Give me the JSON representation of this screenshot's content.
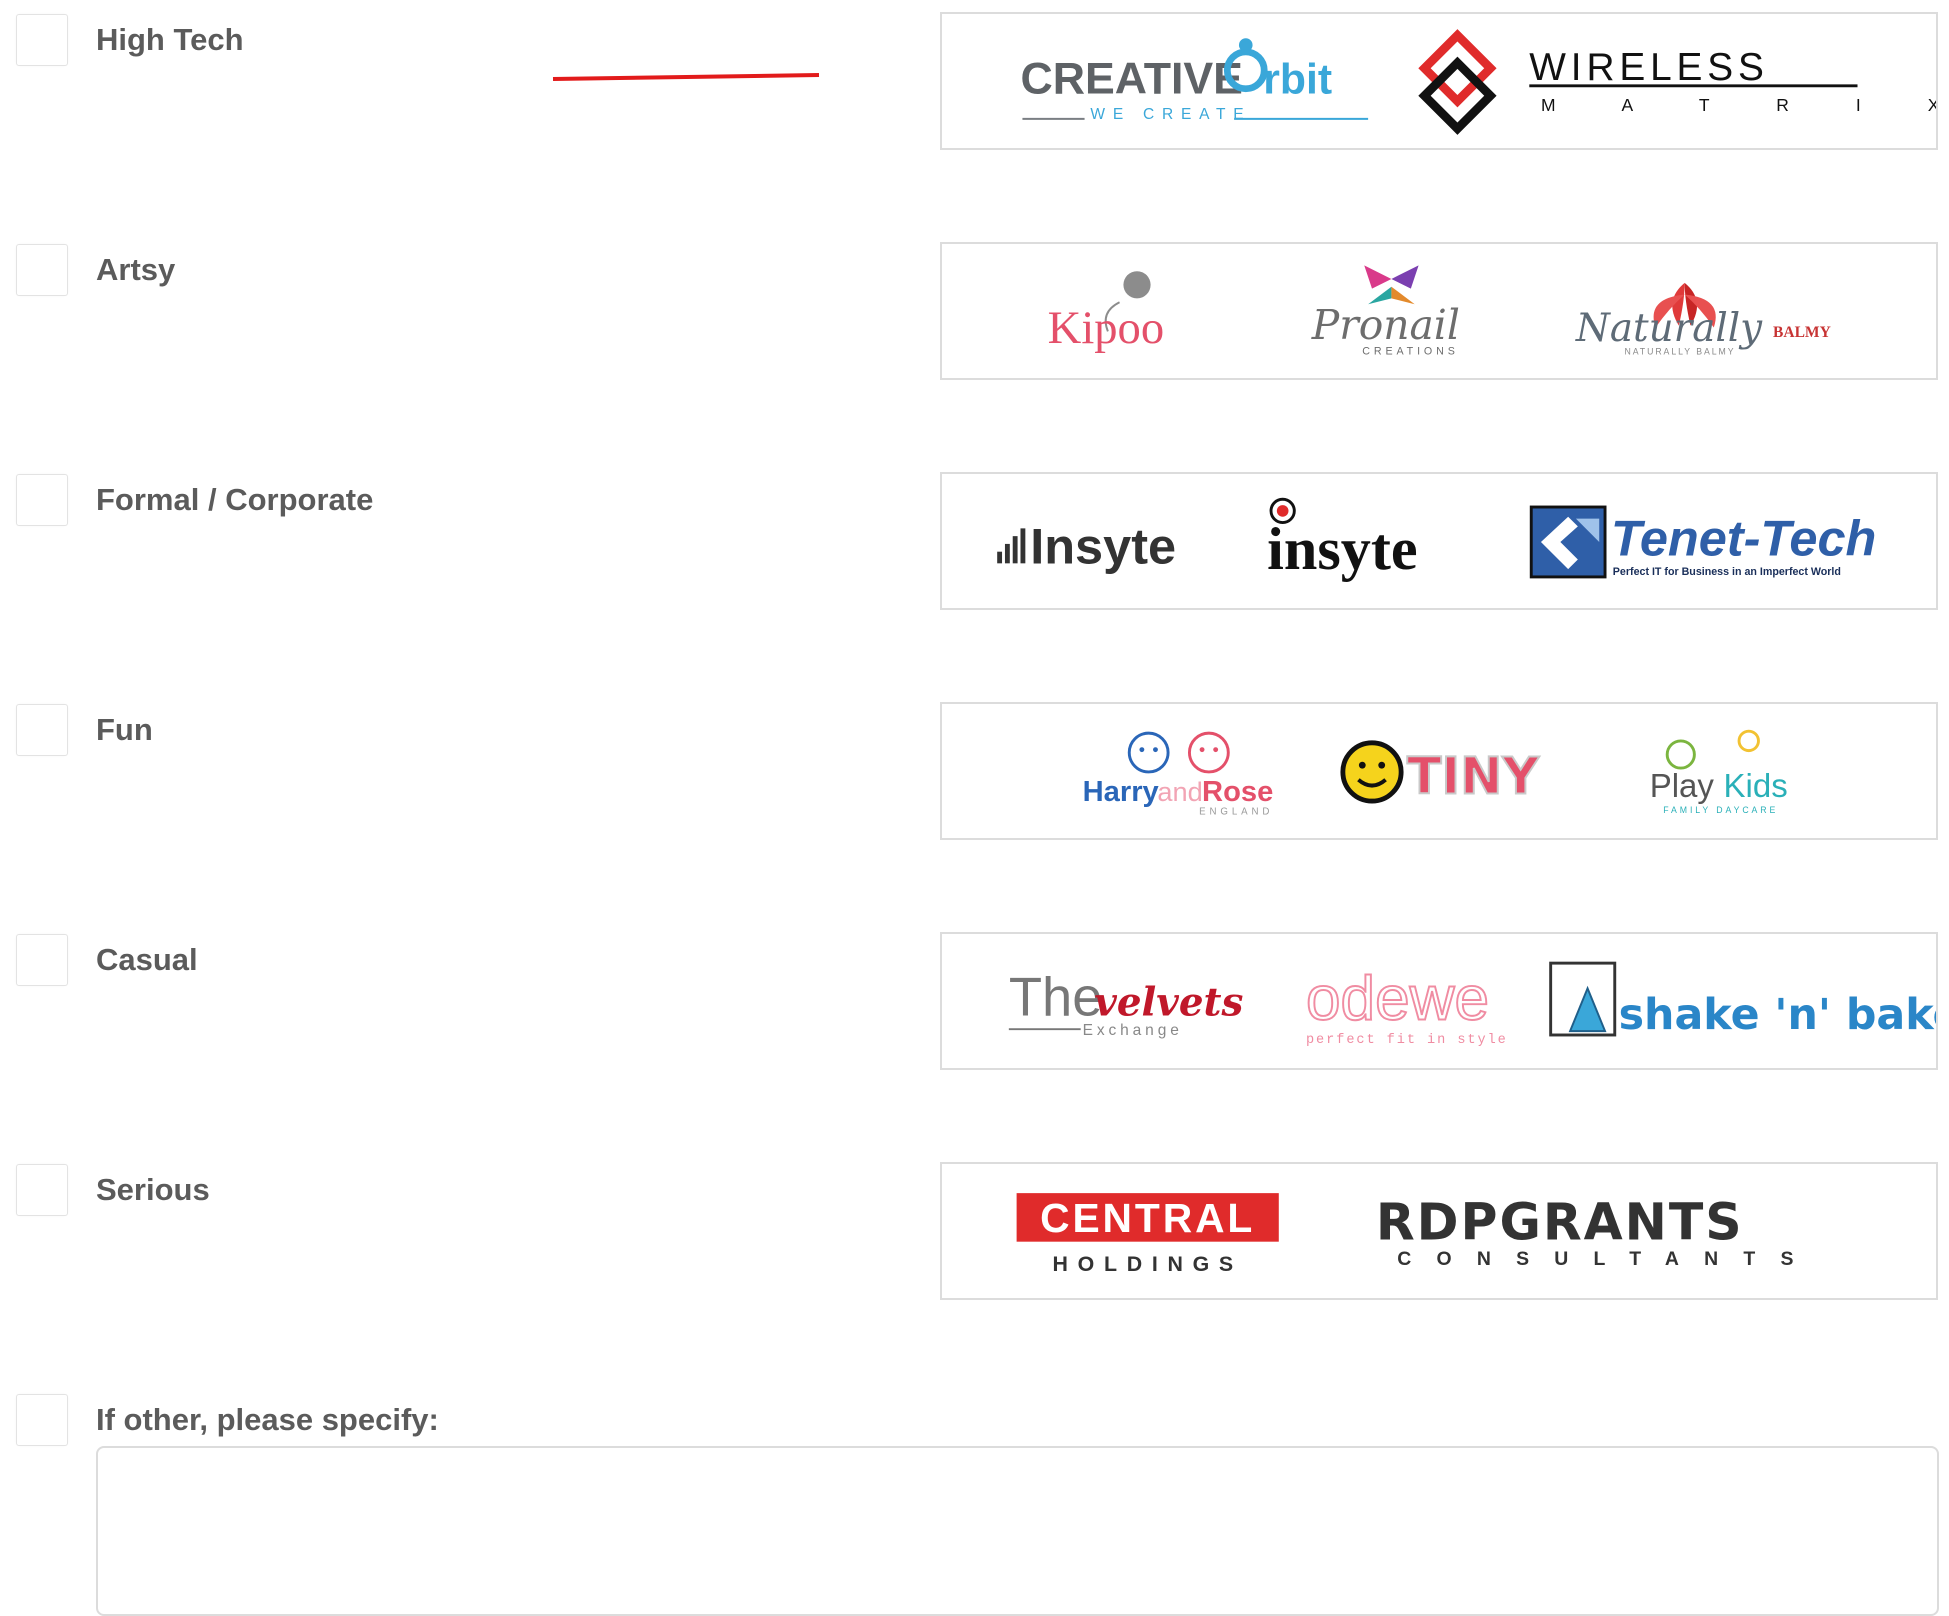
{
  "options": [
    {
      "label": "High Tech",
      "logos": [
        "CREATIVE Orbit — WE CREATE",
        "WIRELESS MATRIX"
      ]
    },
    {
      "label": "Artsy",
      "logos": [
        "Kipoo",
        "Pronail CREATIONS",
        "Naturally BALMY"
      ]
    },
    {
      "label": "Formal / Corporate",
      "logos": [
        "Insyte",
        "insyte",
        "Tenet-Tech — Perfect IT for Business in an Imperfect World"
      ]
    },
    {
      "label": "Fun",
      "logos": [
        "HarryandRose ENGLAND",
        "TINY",
        "PlayKids FAMILY DAYCARE"
      ]
    },
    {
      "label": "Casual",
      "logos": [
        "The velvets Exchange",
        "odewe perfect fit in style",
        "shake 'n' bake"
      ]
    },
    {
      "label": "Serious",
      "logos": [
        "CENTRAL HOLDINGS",
        "RDPGRANTS CONSULTANTS"
      ]
    }
  ],
  "other": {
    "label": "If other, please specify:",
    "value": ""
  },
  "logo_text": {
    "creative": "CREATIVE",
    "orbit": "rbit",
    "we_create": "WE CREATE",
    "wireless": "WIRELESS",
    "matrix": "M A T R I X",
    "kipoo": "Kipoo",
    "pronail": "Pronail",
    "pronail_sub": "CREATIONS",
    "naturally": "Naturally",
    "balmy": "BALMY",
    "naturally_sub": "NATURALLY BALMY",
    "insyte1": "Insyte",
    "insyte2": "insyte",
    "tenet": "Tenet-Tech",
    "tenet_sub": "Perfect IT for Business in an Imperfect World",
    "harry": "Harry",
    "and": "and",
    "rose": "Rose",
    "england": "ENGLAND",
    "tiny": "TINY",
    "play": "Play",
    "kids": "Kids",
    "playkids_sub": "FAMILY DAYCARE",
    "the": "The",
    "velvets": "velvets",
    "exchange": "Exchange",
    "odewe": "odewe",
    "odewe_sub": "perfect fit in style",
    "shake": "shake 'n' bake",
    "central": "CENTRAL",
    "holdings": "HOLDINGS",
    "rdp": "RDPGRANTS",
    "consultants": "CONSULTANTS"
  },
  "colors": {
    "annotation": "#e21b1b",
    "checkbox_border": "#e3e3e3",
    "label": "#5b5b5b",
    "box_border": "#dcdcdc"
  }
}
